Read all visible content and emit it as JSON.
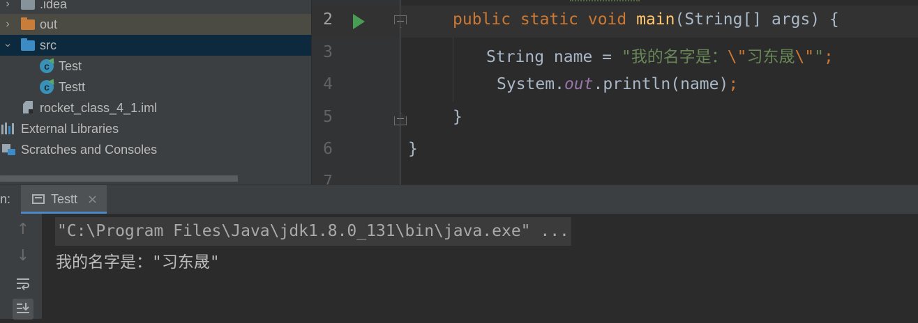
{
  "project_tree": {
    "items": [
      {
        "label": ".idea",
        "icon": "folder-icon"
      },
      {
        "label": "out",
        "icon": "folder-icon",
        "color": "#c87d3a"
      },
      {
        "label": "src",
        "icon": "folder-icon",
        "color": "#3d8bc4"
      },
      {
        "label": "Test",
        "icon": "java-class-icon"
      },
      {
        "label": "Testt",
        "icon": "java-class-icon"
      },
      {
        "label": "rocket_class_4_1.iml",
        "icon": "module-file-icon"
      },
      {
        "label": "External Libraries",
        "icon": "libraries-icon"
      },
      {
        "label": "Scratches and Consoles",
        "icon": "scratches-icon"
      }
    ]
  },
  "editor": {
    "line_numbers": [
      "2",
      "3",
      "4",
      "5",
      "6",
      "7"
    ],
    "lines": {
      "l2": {
        "kw1": "public static void ",
        "fn": "main",
        "rest": "(String[] args) {"
      },
      "l3": {
        "prefix": "String name = ",
        "str1": "\"我的名字是：",
        "esc1": "\\\"",
        "str2": "习东晟",
        "esc2": "\\\"",
        "str3": "\"",
        "semi": ";"
      },
      "l4": {
        "prefix": "System.",
        "field": "out",
        "rest": ".println(name)",
        "semi": ";"
      },
      "l5": {
        "text": "}"
      },
      "l6": {
        "text": "}"
      }
    }
  },
  "run_panel": {
    "prefix": "n:",
    "tab_label": "Testt",
    "close_glyph": "×",
    "command": "\"C:\\Program Files\\Java\\jdk1.8.0_131\\bin\\java.exe\" ...",
    "output": "我的名字是：\"习东晟\"",
    "tools": [
      "up-arrow-icon",
      "down-arrow-icon",
      "soft-wrap-icon",
      "scroll-to-end-icon"
    ]
  },
  "colors": {
    "keyword": "#cc7832",
    "function": "#ffc66d",
    "string": "#6a8759",
    "field": "#9876aa",
    "selection_src": "#0d293e"
  }
}
